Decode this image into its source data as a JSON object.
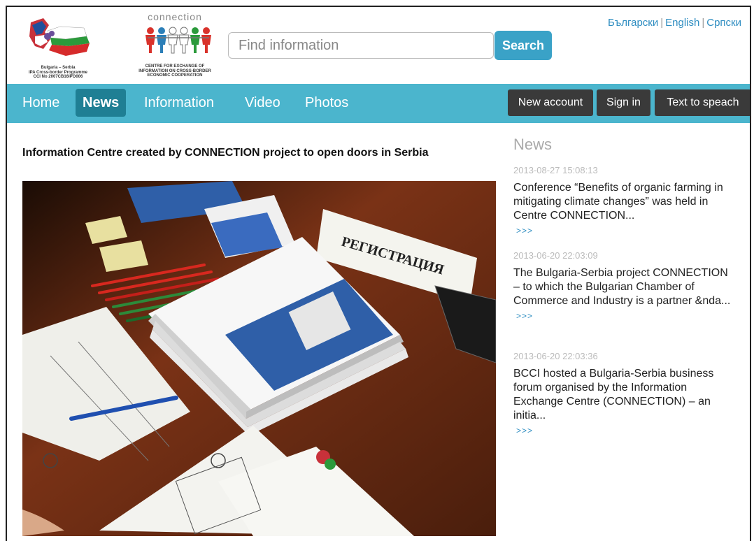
{
  "header": {
    "logo1_text": "Bulgaria – Serbia\nIPA Cross-border Programme\nCCI No 2007CB16IPO006",
    "logo2_title": "connection",
    "logo2_text": "CENTRE FOR EXCHANGE OF\nINFORMATION ON CROSS-BORDER\nECONOMIC COOPERATION",
    "search_placeholder": "Find information",
    "search_button": "Search",
    "languages": [
      "Български",
      "English",
      "Српски"
    ]
  },
  "nav": {
    "items": [
      "Home",
      "News",
      "Information",
      "Video",
      "Photos"
    ],
    "active": "News",
    "buttons": [
      "New account",
      "Sign in",
      "Text to speach"
    ]
  },
  "article": {
    "title": "Information Centre created by CONNECTION project to open doors in Serbia",
    "photo_sign": "РЕГИСТРАЦИЯ"
  },
  "sidebar": {
    "heading": "News",
    "items": [
      {
        "date": "2013-08-27 15:08:13",
        "text": " Conference “Benefits of organic farming in mitigating climate changes” was held in Centre CONNECTION...",
        "more": ">>>"
      },
      {
        "date": "2013-06-20 22:03:09",
        "text": "The Bulgaria-Serbia project CONNECTION – to which the Bulgarian Chamber of Commerce and Industry is a partner &nda...",
        "more": ">>>"
      },
      {
        "date": "2013-06-20 22:03:36",
        "text": "BCCI hosted a Bulgaria-Serbia business forum organised by the Information Exchange Centre (CONNECTION) – an initia...",
        "more": ">>>"
      }
    ]
  },
  "colors": {
    "nav_bg": "#4bb5cd",
    "nav_active": "#1f7f94",
    "search_button": "#3aa2c7",
    "link": "#2e8dc1",
    "dark_button": "#3a3a3a"
  }
}
